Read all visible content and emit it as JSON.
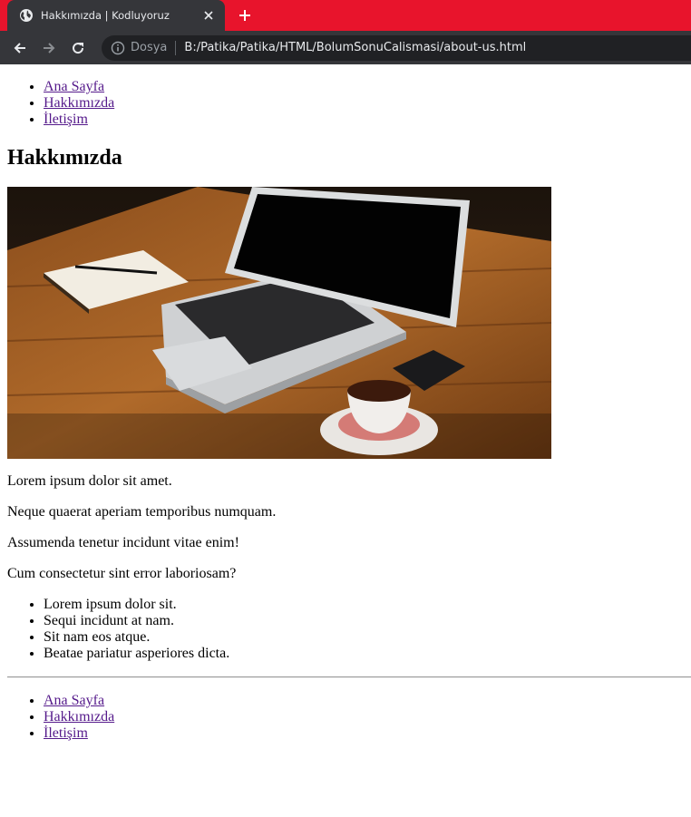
{
  "browser": {
    "tab_title": "Hakkımızda | Kodluyoruz",
    "address_scheme": "Dosya",
    "address_url": "B:/Patika/Patika/HTML/BolumSonuCalismasi/about-us.html",
    "accent_color": "#e8142c"
  },
  "nav_top": {
    "items": [
      "Ana Sayfa",
      "Hakkımızda",
      "İletişim"
    ]
  },
  "page": {
    "heading": "Hakkımızda",
    "paragraphs": [
      "Lorem ipsum dolor sit amet.",
      "Neque quaerat aperiam temporibus numquam.",
      "Assumenda tenetur incidunt vitae enim!",
      "Cum consectetur sint error laboriosam?"
    ],
    "list": [
      "Lorem ipsum dolor sit.",
      "Sequi incidunt at nam.",
      "Sit nam eos atque.",
      "Beatae pariatur asperiores dicta."
    ]
  },
  "nav_bottom": {
    "items": [
      "Ana Sayfa",
      "Hakkımızda",
      "İletişim"
    ]
  },
  "icons": [
    "globe-icon",
    "close-icon",
    "plus-icon",
    "back-arrow-icon",
    "forward-arrow-icon",
    "reload-icon",
    "info-icon"
  ]
}
